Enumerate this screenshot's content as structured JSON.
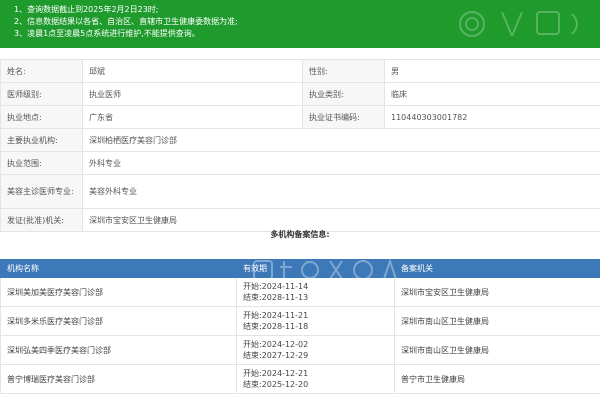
{
  "notice": {
    "items": [
      "1、查询数据截止到2025年2月2日23时;",
      "2、信息数据结果以各省、自治区、直辖市卫生健康委数据为准;",
      "3、凌晨1点至凌晨5点系统进行维护,不能提供查询。"
    ]
  },
  "doctor": {
    "name_label": "姓名:",
    "name": "邱斌",
    "gender_label": "性别:",
    "gender": "男",
    "level_label": "医师级别:",
    "level": "执业医师",
    "category_label": "执业类别:",
    "category": "临床",
    "location_label": "执业地点:",
    "location": "广东省",
    "cert_label": "执业证书编码:",
    "cert": "110440303001782",
    "org_label": "主要执业机构:",
    "org": "深圳柏栖医疗美容门诊部",
    "scope_label": "执业范围:",
    "scope": "外科专业",
    "cosmetic_label": "美容主诊医师专业:",
    "cosmetic": "美容外科专业",
    "issuer_label": "发证(批准)机关:",
    "issuer": "深圳市宝安区卫生健康局"
  },
  "multi": {
    "title": "多机构备案信息:",
    "headers": {
      "org": "机构名称",
      "validity": "有效期",
      "authority": "备案机关"
    },
    "rows": [
      {
        "org": "深圳美加美医疗美容门诊部",
        "start": "开始:2024-11-14",
        "end": "结束:2028-11-13",
        "authority": "深圳市宝安区卫生健康局"
      },
      {
        "org": "深圳多米乐医疗美容门诊部",
        "start": "开始:2024-11-21",
        "end": "结束:2028-11-18",
        "authority": "深圳市南山区卫生健康局"
      },
      {
        "org": "深圳弘美四季医疗美容门诊部",
        "start": "开始:2024-12-02",
        "end": "结束:2027-12-29",
        "authority": "深圳市南山区卫生健康局"
      },
      {
        "org": "普宁博瑞医疗美容门诊部",
        "start": "开始:2024-12-21",
        "end": "结束:2025-12-20",
        "authority": "普宁市卫生健康局"
      }
    ]
  },
  "colors": {
    "notice_bg": "#1e9b2c",
    "header_bg": "#3d78b8",
    "label_bg": "#f7f7f7",
    "border": "#e4e4e4"
  }
}
